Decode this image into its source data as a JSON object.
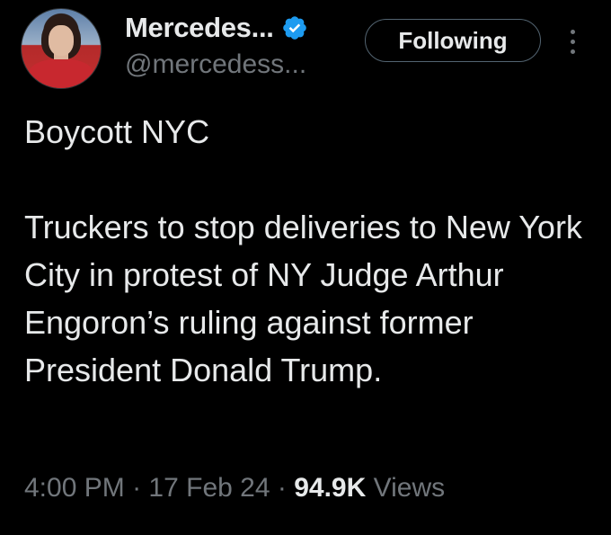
{
  "author": {
    "display_name": "Mercedes...",
    "handle": "@mercedess...",
    "verified": true
  },
  "actions": {
    "follow_label": "Following"
  },
  "tweet": {
    "line1": "Boycott NYC",
    "body": "Truckers to stop deliveries to New York City in protest of NY Judge Arthur Engoron’s ruling against former President Donald Trump."
  },
  "meta": {
    "time": "4:00 PM",
    "sep1": "·",
    "date": "17 Feb 24",
    "sep2": "·",
    "views_count": "94.9K",
    "views_label": "Views"
  },
  "colors": {
    "background": "#000000",
    "text": "#e7e9ea",
    "secondary": "#71767b",
    "verified": "#1d9bf0"
  }
}
